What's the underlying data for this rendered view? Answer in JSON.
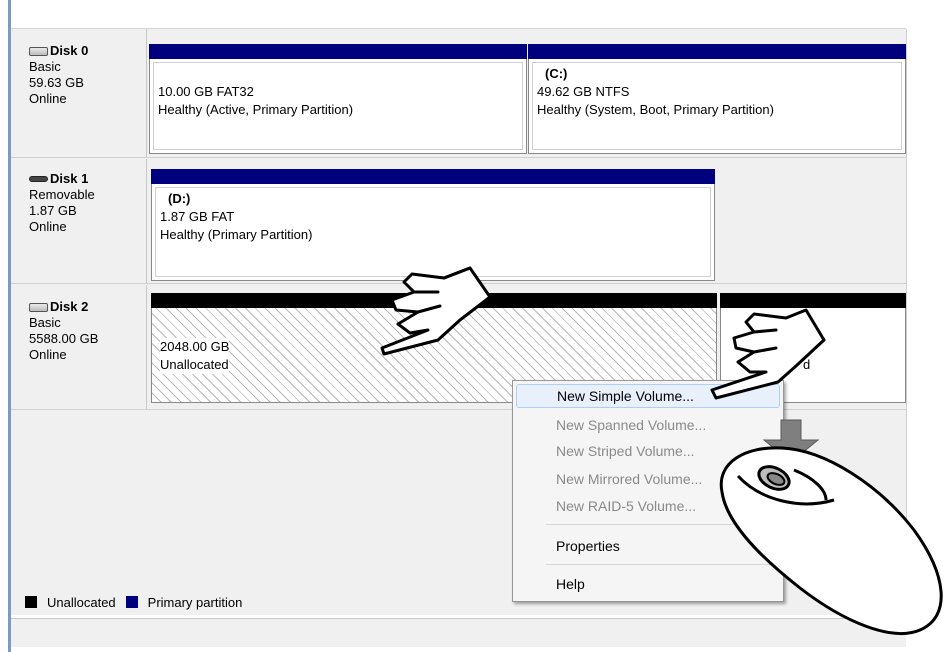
{
  "disks": [
    {
      "name": "Disk 0",
      "type": "Basic",
      "size": "59.63 GB",
      "status": "Online",
      "icon": "hard-disk-icon",
      "partitions": [
        {
          "drive": "",
          "size_fs": "10.00 GB FAT32",
          "health": "Healthy (Active, Primary Partition)"
        },
        {
          "drive": "(C:)",
          "size_fs": "49.62 GB NTFS",
          "health": "Healthy (System, Boot, Primary Partition)"
        }
      ]
    },
    {
      "name": "Disk 1",
      "type": "Removable",
      "size": "1.87 GB",
      "status": "Online",
      "icon": "removable-disk-icon",
      "partitions": [
        {
          "drive": "(D:)",
          "size_fs": "1.87 GB FAT",
          "health": "Healthy (Primary Partition)"
        }
      ]
    },
    {
      "name": "Disk 2",
      "type": "Basic",
      "size": "5588.00 GB",
      "status": "Online",
      "icon": "hard-disk-icon",
      "partitions": [
        {
          "size": "2048.00 GB",
          "state": "Unallocated"
        },
        {
          "state_fragment": "d"
        }
      ]
    }
  ],
  "context_menu": {
    "items": [
      {
        "label": "New Simple Volume...",
        "enabled": true
      },
      {
        "label": "New Spanned Volume...",
        "enabled": false
      },
      {
        "label": "New Striped Volume...",
        "enabled": false
      },
      {
        "label": "New Mirrored Volume...",
        "enabled": false
      },
      {
        "label": "New RAID-5 Volume...",
        "enabled": false
      },
      {
        "label": "Properties",
        "enabled": true
      },
      {
        "label": "Help",
        "enabled": true
      }
    ]
  },
  "legend": {
    "unallocated": "Unallocated",
    "primary": "Primary partition"
  },
  "colors": {
    "primary_partition": "#00007f",
    "unallocated": "#000000",
    "menu_highlight": "#e8f1fb"
  },
  "annotations": {
    "icons": [
      "pointing-hand-icon",
      "pointing-hand-icon",
      "down-arrow-icon",
      "mouse-right-click-icon"
    ]
  }
}
